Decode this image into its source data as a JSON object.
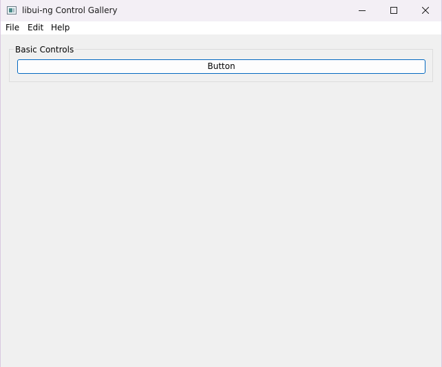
{
  "window": {
    "title": "libui-ng Control Gallery",
    "controls": {
      "minimize": "minimize-icon",
      "maximize": "maximize-icon",
      "close": "close-icon"
    }
  },
  "menubar": {
    "items": [
      {
        "label": "File"
      },
      {
        "label": "Edit"
      },
      {
        "label": "Help"
      }
    ]
  },
  "basic_controls": {
    "group_label": "Basic Controls",
    "button_label": "Button"
  },
  "colors": {
    "button_border": "#0067c0",
    "window_background": "#f0f0f0"
  }
}
